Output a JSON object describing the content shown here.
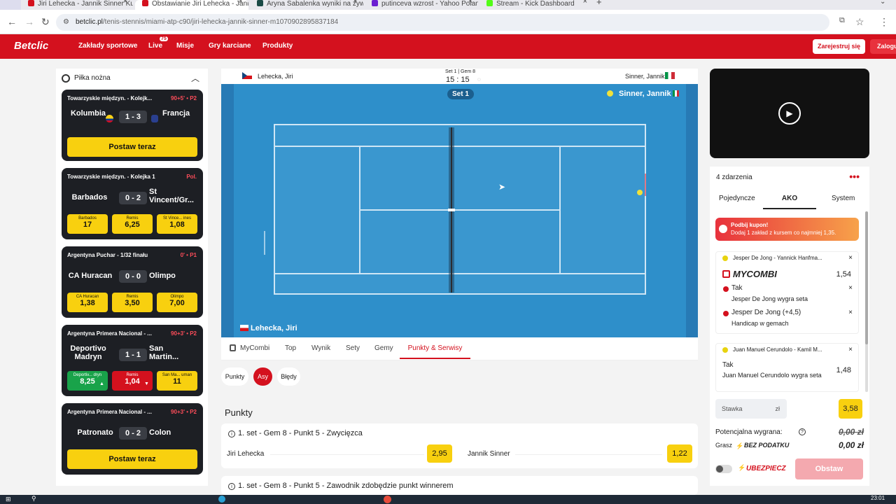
{
  "browser": {
    "tabs": [
      {
        "label": "Jiri Lehecka - Jannik Sinner Kurs",
        "color": "#d4111e"
      },
      {
        "label": "Obstawianie Jiri Lehecka - Janni",
        "color": "#d4111e",
        "active": true
      },
      {
        "label": "Aryna Sabalenka wyniki na żywo",
        "color": "#1a4a46"
      },
      {
        "label": "putinceva wzrost - Yahoo Polan",
        "color": "#6b1fd1"
      },
      {
        "label": "Stream - Kick Dashboard",
        "color": "#53fc18"
      }
    ],
    "url_site": "betclic.pl",
    "url_path": "/tenis-stennis/miami-atp-c90/jiri-lehecka-jannik-sinner-m1070902895837184"
  },
  "nav": {
    "logo": "Betclic",
    "items": [
      "Zakłady sportowe",
      "Live",
      "Misje",
      "Gry karciane",
      "Produkty"
    ],
    "live_badge": "75",
    "register": "Zarejestruj się",
    "login": "Zaloguj"
  },
  "sidebar": {
    "sport": "Piłka nożna",
    "cards": [
      {
        "league": "Towarzyskie międzyn. - Kolejk...",
        "live": "90+5' • P2",
        "team1": "Kolumbia",
        "team2": "Francja",
        "score": "1 - 3",
        "cta": "Postaw teraz"
      },
      {
        "league": "Towarzyskie międzyn. - Kolejka 1",
        "live": "Pol.",
        "team1": "Barbados",
        "team2": "St Vincent/Gr...",
        "score": "0 - 2",
        "odds": [
          {
            "label": "Barbados",
            "value": "17"
          },
          {
            "label": "Remis",
            "value": "6,25"
          },
          {
            "label": "St Vince... ines",
            "value": "1,08"
          }
        ]
      },
      {
        "league": "Argentyna Puchar - 1/32 finału",
        "live": "0' • P1",
        "team1": "CA Huracan",
        "team2": "Olimpo",
        "score": "0 - 0",
        "odds": [
          {
            "label": "CA Huracan",
            "value": "1,38"
          },
          {
            "label": "Remis",
            "value": "3,50"
          },
          {
            "label": "Olimpo",
            "value": "7,00"
          }
        ]
      },
      {
        "league": "Argentyna Primera Nacional - ...",
        "live": "90+3' • P2",
        "team1": "Deportivo Madryn",
        "team2": "San Martin...",
        "score": "1 - 1",
        "odds": [
          {
            "label": "Deportiv... dryn",
            "value": "8,25"
          },
          {
            "label": "Remis",
            "value": "1,04"
          },
          {
            "label": "San Ma... uman",
            "value": "11"
          }
        ]
      },
      {
        "league": "Argentyna Primera Nacional - ...",
        "live": "90+3' • P2",
        "team1": "Patronato",
        "team2": "Colon",
        "score": "0 - 2",
        "cta": "Postaw teraz"
      }
    ]
  },
  "match": {
    "player1": "Lehecka, Jiri",
    "player2": "Sinner, Jannik",
    "set_info": "Set 1 | Gem 8",
    "game_score": "15 : 15",
    "set_badge": "Set 1",
    "server_label": "Sinner, Jannik",
    "bottom_label": "Lehecka, Jiri"
  },
  "market_tabs": [
    "MyCombi",
    "Top",
    "Wynik",
    "Sety",
    "Gemy",
    "Punkty & Serwisy"
  ],
  "filters": [
    "Punkty",
    "Asy",
    "Błędy"
  ],
  "section_title": "Punkty",
  "markets": [
    {
      "title": "1. set - Gem 8 - Punkt 5 - Zwycięzca",
      "p1": "Jiri Lehecka",
      "o1": "2,95",
      "p2": "Jannik Sinner",
      "o2": "1,22"
    },
    {
      "title": "1. set - Gem 8 - Punkt 5 - Zawodnik zdobędzie punkt winnerem"
    }
  ],
  "slip": {
    "count": "4 zdarzenia",
    "tabs": [
      "Pojedyncze",
      "AKO",
      "System"
    ],
    "promo_title": "Podbij kupon!",
    "promo_text": "Dodaj 1 zakład z kursem co najmniej 1,35.",
    "bet1_event": "Jesper De Jong - Yannick Hanfma...",
    "mycombi": "MYCOMBI",
    "bet1_odds": "1,54",
    "sel1_title": "Tak",
    "sel1_desc": "Jesper De Jong wygra seta",
    "sel2_title": "Jesper De Jong (+4,5)",
    "sel2_desc": "Handicap w gemach",
    "bet2_event": "Juan Manuel Cerundolo - Kamil M...",
    "sel3_title": "Tak",
    "sel3_desc": "Juan Manuel Cerundolo wygra seta",
    "bet2_odds": "1,48",
    "stake_label": "Stawka",
    "currency": "zł",
    "total_odds": "3,58",
    "potential_label": "Potencjalna wygrana:",
    "potential_value": "0,00 zł",
    "tax_label": "Grasz",
    "tax_brand": "BEZ PODATKU",
    "tax_value": "0,00 zł",
    "insure": "UBEZPIECZ",
    "submit": "Obstaw"
  },
  "taskbar": {
    "clock": "23:01"
  }
}
